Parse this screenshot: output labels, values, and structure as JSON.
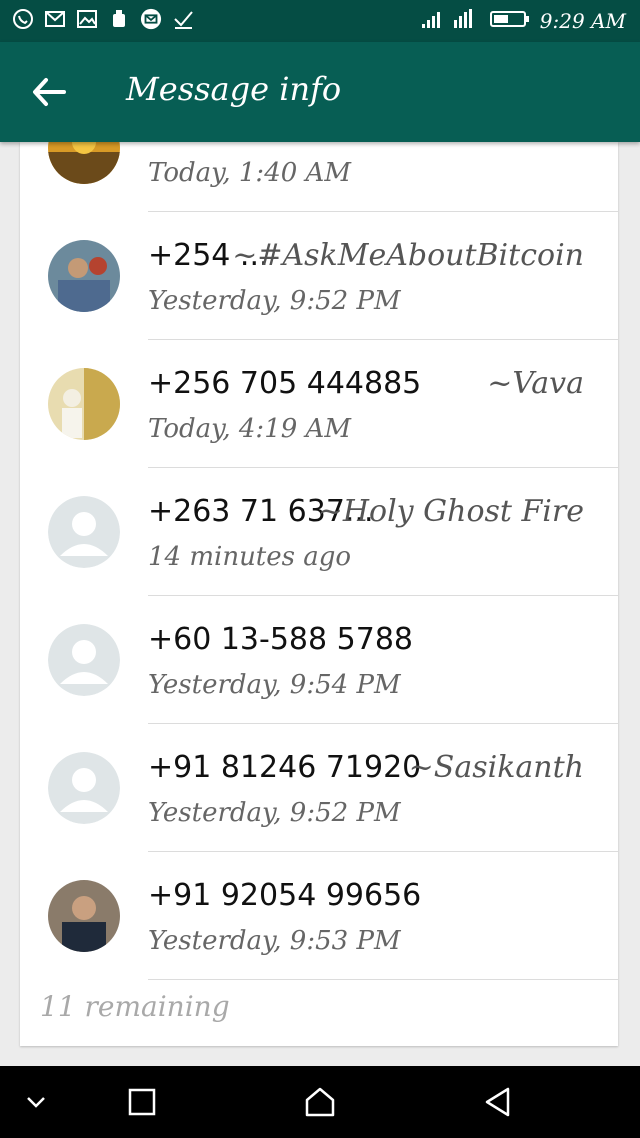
{
  "status_bar": {
    "time": "9:29 AM",
    "icons": [
      "whatsapp-icon",
      "gmail-icon",
      "image-icon",
      "android-icon",
      "mail-icon",
      "check-icon"
    ]
  },
  "header": {
    "title": "Message info"
  },
  "recipients": [
    {
      "name": "",
      "alias": "",
      "time": "Today, 1:40 AM",
      "avatar": "photo-sunset"
    },
    {
      "name": "+254 ...",
      "alias": "~#AskMeAboutBitcoin",
      "time": "Yesterday, 9:52 PM",
      "avatar": "photo-people"
    },
    {
      "name": "+256 705 444885",
      "alias": "~Vava",
      "time": "Today, 4:19 AM",
      "avatar": "photo-wedding"
    },
    {
      "name": "+263 71 637...",
      "alias": "~Holy Ghost Fire",
      "time": "14 minutes ago",
      "avatar": "default"
    },
    {
      "name": "+60 13-588 5788",
      "alias": "",
      "time": "Yesterday, 9:54 PM",
      "avatar": "default"
    },
    {
      "name": "+91 81246 71920",
      "alias": "~Sasikanth",
      "time": "Yesterday, 9:52 PM",
      "avatar": "default"
    },
    {
      "name": "+91 92054 99656",
      "alias": "",
      "time": "Yesterday, 9:53 PM",
      "avatar": "photo-man"
    }
  ],
  "remaining_text": "11 remaining",
  "colors": {
    "header": "#075e54",
    "status_bar": "#054d44"
  }
}
